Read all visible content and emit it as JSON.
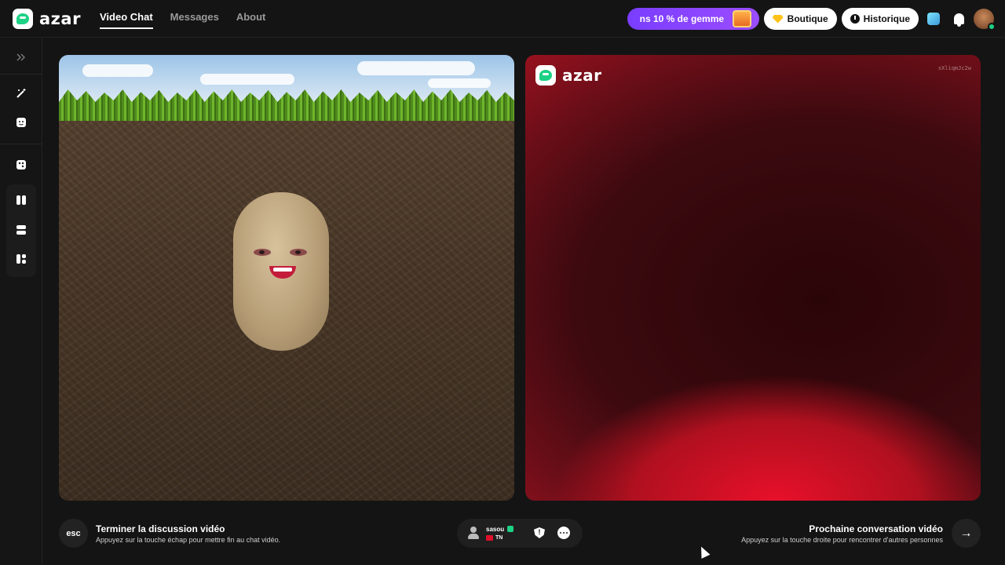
{
  "app": {
    "logo_text": "azar"
  },
  "nav": {
    "items": [
      {
        "label": "Video Chat",
        "active": true
      },
      {
        "label": "Messages",
        "active": false
      },
      {
        "label": "About",
        "active": false
      }
    ]
  },
  "header": {
    "promo_label": "ns 10 % de gemme",
    "shop_label": "Boutique",
    "history_label": "Historique",
    "icons": [
      "gem-icon",
      "clock-icon",
      "cube-icon",
      "bell-icon",
      "avatar"
    ]
  },
  "sidebar": {
    "icons": [
      "expand-icon",
      "magic-wand-icon",
      "face-filter-icon",
      "dice-icon",
      "layout-side-by-side-icon",
      "layout-stacked-icon",
      "layout-grid-icon"
    ]
  },
  "remote": {
    "watermark": "azar",
    "session_id": "sXliqmJc2w"
  },
  "bottom": {
    "esc_key": "esc",
    "end_title": "Terminer la discussion vidéo",
    "end_subtitle": "Appuyez sur la touche échap pour mettre fin au chat vidéo.",
    "peer_name": "sasou",
    "peer_country": "TN",
    "next_title": "Prochaine conversation vidéo",
    "next_subtitle": "Appuyez sur la touche droite pour rencontrer d'autres personnes",
    "next_arrow": "→"
  },
  "colors": {
    "accent": "#1dd185",
    "promo": "#8b45ff",
    "remote_red": "#d0102a"
  }
}
